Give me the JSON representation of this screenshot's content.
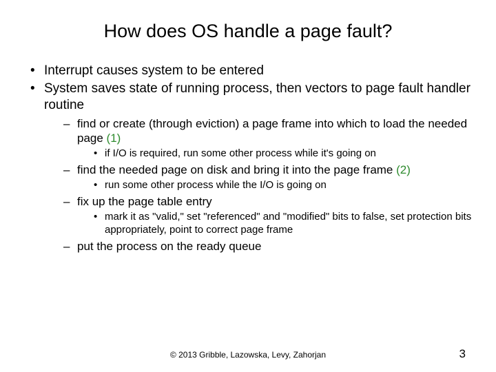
{
  "title": "How does OS handle a page fault?",
  "b1": "Interrupt causes system to be entered",
  "b2": "System saves state of running process, then vectors to page fault handler routine",
  "d1a": "find or create (through eviction) a page frame into which to load the needed page ",
  "d1n": "(1)",
  "d1s": "if I/O is required, run some other process while it's going on",
  "d2a": "find the needed page on disk and bring it into the page frame ",
  "d2n": "(2)",
  "d2s": "run some other process while the I/O is going on",
  "d3": "fix up the page table entry",
  "d3s": "mark it as \"valid,\" set \"referenced\" and \"modified\" bits to false, set protection bits appropriately, point to correct page frame",
  "d4": "put the process on the ready queue",
  "footer": "© 2013 Gribble, Lazowska, Levy, Zahorjan",
  "page": "3"
}
